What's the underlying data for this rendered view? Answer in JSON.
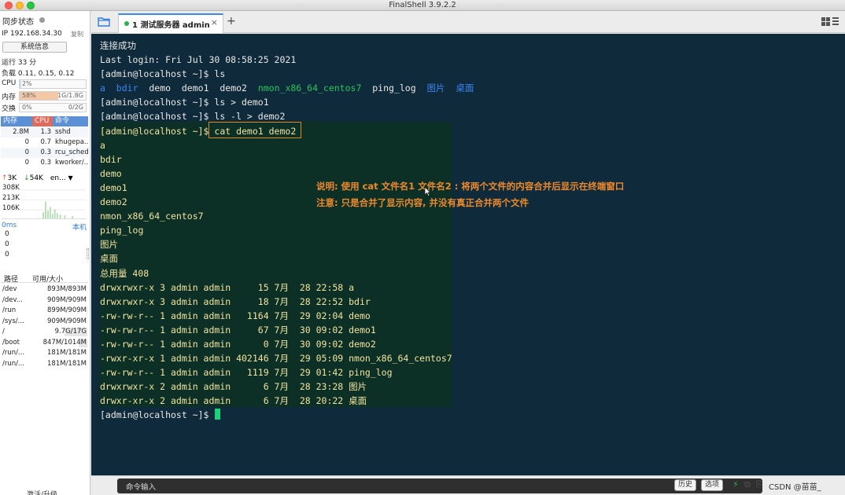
{
  "window": {
    "title": "FinalShell 3.9.2.2"
  },
  "sidebar": {
    "sync_label": "同步状态",
    "ip": "IP 192.168.34.30",
    "copy": "复制",
    "sysinfo_button": "系统信息",
    "uptime": "运行 33 分",
    "load": "负载 0.11, 0.15, 0.12",
    "cpu": {
      "label": "CPU",
      "value": "2%",
      "fraction": 0.02
    },
    "mem": {
      "label": "内存",
      "value": "58%",
      "detail": "1G/1.8G",
      "fraction": 0.58
    },
    "swap": {
      "label": "交换",
      "value": "0%",
      "detail": "0/2G",
      "fraction": 0.0
    },
    "proc_headers": [
      "内存",
      "CPU",
      "命令"
    ],
    "processes": [
      {
        "mem": "2.8M",
        "cpu": "1.3",
        "cmd": "sshd"
      },
      {
        "mem": "0",
        "cpu": "0.7",
        "cmd": "khugepa..."
      },
      {
        "mem": "0",
        "cpu": "0.3",
        "cmd": "rcu_sched"
      },
      {
        "mem": "0",
        "cpu": "0.3",
        "cmd": "kworker/..."
      }
    ],
    "net": {
      "up": "3K",
      "down": "54K",
      "iface": "en...",
      "ticks": [
        "308K",
        "213K",
        "106K"
      ]
    },
    "ping": {
      "latency": "0ms",
      "host": "本机",
      "values": [
        "0",
        "0",
        "0"
      ]
    },
    "fs_headers": [
      "路径",
      "可用/大小"
    ],
    "filesystems": [
      {
        "path": "/dev",
        "value": "893M/893M",
        "used": 0.0
      },
      {
        "path": "/dev...",
        "value": "909M/909M",
        "used": 0.0
      },
      {
        "path": "/run",
        "value": "899M/909M",
        "used": 0.01
      },
      {
        "path": "/sys/...",
        "value": "909M/909M",
        "used": 0.0
      },
      {
        "path": "/",
        "value": "9.7G/17G",
        "used": 0.43
      },
      {
        "path": "/boot",
        "value": "847M/1014M",
        "used": 0.16
      },
      {
        "path": "/run/...",
        "value": "181M/181M",
        "used": 0.0
      },
      {
        "path": "/run/...",
        "value": "181M/181M",
        "used": 0.0
      }
    ],
    "activate": "激活/升级"
  },
  "tabs": [
    {
      "label": "1 测试服务器 admin",
      "close": "×"
    }
  ],
  "tab_add": "+",
  "terminal": {
    "lines": [
      [
        {
          "t": "连接成功"
        }
      ],
      [
        {
          "t": "Last login: Fri Jul 30 08:58:25 2021"
        }
      ],
      [
        {
          "t": "[admin@localhost ~]$ ls"
        }
      ],
      [
        {
          "t": "a",
          "c": "blue"
        },
        {
          "t": "  "
        },
        {
          "t": "bdir",
          "c": "blue"
        },
        {
          "t": "  demo  demo1  demo2  "
        },
        {
          "t": "nmon_x86_64_centos7",
          "c": "green"
        },
        {
          "t": "  ping_log  "
        },
        {
          "t": "图片",
          "c": "blue"
        },
        {
          "t": "  "
        },
        {
          "t": "桌面",
          "c": "blue"
        }
      ],
      [
        {
          "t": "[admin@localhost ~]$ ls > demo1"
        }
      ],
      [
        {
          "t": "[admin@localhost ~]$ ls -l > demo2"
        }
      ],
      [
        {
          "t": "[admin@localhost ~]$ cat demo1 demo2",
          "c": "yellow"
        }
      ],
      [
        {
          "t": "a",
          "c": "yellow"
        }
      ],
      [
        {
          "t": "bdir",
          "c": "yellow"
        }
      ],
      [
        {
          "t": "demo",
          "c": "yellow"
        }
      ],
      [
        {
          "t": "demo1",
          "c": "yellow"
        }
      ],
      [
        {
          "t": "demo2",
          "c": "yellow"
        }
      ],
      [
        {
          "t": "nmon_x86_64_centos7",
          "c": "yellow"
        }
      ],
      [
        {
          "t": "ping_log",
          "c": "yellow"
        }
      ],
      [
        {
          "t": "图片",
          "c": "yellow"
        }
      ],
      [
        {
          "t": "桌面",
          "c": "yellow"
        }
      ],
      [
        {
          "t": "总用量 408",
          "c": "yellow"
        }
      ],
      [
        {
          "t": "drwxrwxr-x 3 admin admin     15 7月  28 22:58 a",
          "c": "yellow"
        }
      ],
      [
        {
          "t": "drwxrwxr-x 3 admin admin     18 7月  28 22:52 bdir",
          "c": "yellow"
        }
      ],
      [
        {
          "t": "-rw-rw-r-- 1 admin admin   1164 7月  29 02:04 demo",
          "c": "yellow"
        }
      ],
      [
        {
          "t": "-rw-rw-r-- 1 admin admin     67 7月  30 09:02 demo1",
          "c": "yellow"
        }
      ],
      [
        {
          "t": "-rw-rw-r-- 1 admin admin      0 7月  30 09:02 demo2",
          "c": "yellow"
        }
      ],
      [
        {
          "t": "-rwxr-xr-x 1 admin admin 402146 7月  29 05:09 nmon_x86_64_centos7",
          "c": "yellow"
        }
      ],
      [
        {
          "t": "-rw-rw-r-- 1 admin admin   1119 7月  29 01:42 ping_log",
          "c": "yellow"
        }
      ],
      [
        {
          "t": "drwxrwxr-x 2 admin admin      6 7月  28 23:28 图片",
          "c": "yellow"
        }
      ],
      [
        {
          "t": "drwxr-xr-x 2 admin admin      6 7月  28 20:22 桌面",
          "c": "yellow"
        }
      ],
      [
        {
          "t": "[admin@localhost ~]$ "
        }
      ]
    ],
    "notes": [
      "说明: 使用 cat 文件名1 文件名2 : 将两个文件的内容合并后显示在终端窗口",
      "注意: 只是合并了显示内容, 并没有真正合并两个文件"
    ]
  },
  "cmdbar": {
    "placeholder": "命令输入",
    "history": "历史",
    "options": "选项",
    "watermark": "CSDN @苗苗_"
  }
}
